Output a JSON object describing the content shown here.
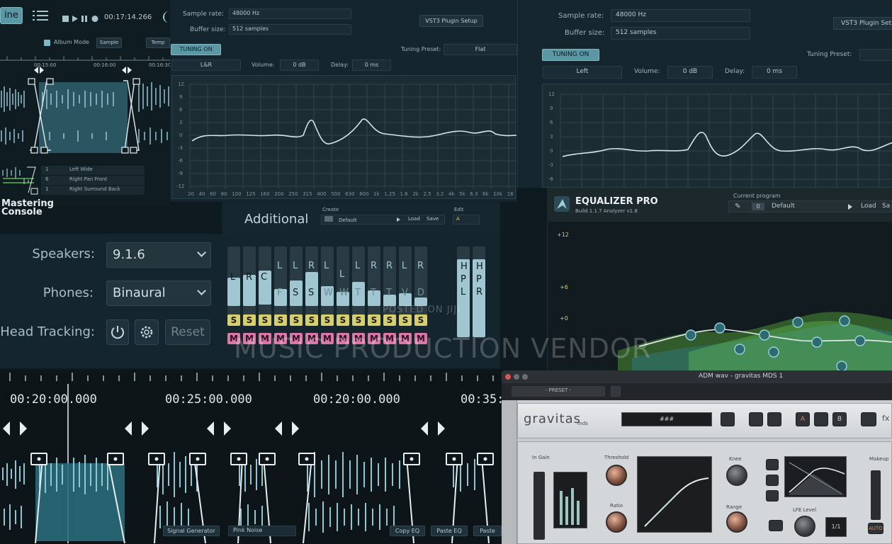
{
  "transport": {
    "play_label": "ine",
    "timecode": "00:17:14.266",
    "tab_a": "Sample",
    "tab_b": "Temp",
    "check_label": "Album Mode"
  },
  "small_timeline": {
    "marks": [
      "00:15:00",
      "00:16:00",
      "00:16:30"
    ]
  },
  "track_list": {
    "rows": [
      {
        "num": "1",
        "name": "Left Wide"
      },
      {
        "num": "6",
        "name": "Right Pan Front"
      },
      {
        "num": "1",
        "name": "Right Surround Back"
      }
    ]
  },
  "brand": {
    "line1": "Mastering",
    "line2": "Console"
  },
  "settings_a": {
    "sample_rate_label": "Sample rate:",
    "sample_rate": "48000 Hz",
    "buffer_label": "Buffer size:",
    "buffer": "512 samples",
    "vst_button": "VST3 Plugin Setup",
    "tuning_button": "TUNING ON",
    "tuning_preset_label": "Tuning Preset:",
    "tuning_preset": "Flat",
    "channel": "L&R",
    "volume_label": "Volume:",
    "volume": "0 dB",
    "delay_label": "Delay:",
    "delay": "0 ms"
  },
  "settings_b": {
    "sample_rate_label": "Sample rate:",
    "sample_rate": "48000 Hz",
    "buffer_label": "Buffer size:",
    "buffer": "512 samples",
    "vst_button": "VST3 Plugin Setup",
    "tuning_button": "TUNING ON",
    "tuning_preset_label": "Tuning Preset:",
    "channel": "Left",
    "volume_label": "Volume:",
    "volume": "0 dB",
    "delay_label": "Delay:",
    "delay": "0 ms"
  },
  "plot_a": {
    "y_ticks": [
      "12",
      "9",
      "6",
      "3",
      "0",
      "-3",
      "-6",
      "-9",
      "-12"
    ],
    "x_ticks": [
      "20",
      "40",
      "60",
      "80",
      "100",
      "125",
      "160",
      "200",
      "250",
      "315",
      "400",
      "500",
      "630",
      "800",
      "1k",
      "1.25",
      "1.6",
      "2k",
      "2.5",
      "3.2",
      "4k",
      "5k",
      "6.3",
      "8k",
      "10k",
      "16"
    ]
  },
  "plot_b": {
    "y_ticks": [
      "12",
      "9",
      "6",
      "3",
      "0",
      "-3",
      "-6"
    ]
  },
  "additional": {
    "title": "Additional",
    "preset_caption": "Create",
    "preset_value": "Default",
    "load": "Load",
    "save": "Save",
    "edit_caption": "Edit",
    "edit_value": "A"
  },
  "speaker": {
    "speakers_label": "Speakers:",
    "speakers_value": "9.1.6",
    "phones_label": "Phones:",
    "phones_value": "Binaural",
    "head_label": "Head Tracking:",
    "reset_label": "Reset"
  },
  "mixer": {
    "channels": [
      "L",
      "R",
      "C",
      "L",
      "L",
      "R",
      "L",
      "L",
      "L",
      "R",
      "R",
      "L",
      "R"
    ],
    "lower_letters": [
      "",
      "",
      "",
      "F",
      "S",
      "S",
      "W",
      "W",
      "T",
      "T",
      "T",
      "V",
      "D"
    ],
    "solo": [
      "S",
      "S",
      "S",
      "S",
      "S",
      "S",
      "S",
      "S",
      "S",
      "S",
      "S",
      "S",
      "S"
    ],
    "mute": [
      "M",
      "M",
      "M",
      "M",
      "M",
      "M",
      "M",
      "M",
      "M",
      "M",
      "M",
      "M",
      "M"
    ],
    "extra_a": [
      "H",
      "P",
      "L"
    ],
    "extra_b": [
      "H",
      "P",
      "R"
    ]
  },
  "big_timeline": {
    "marks": [
      "00:20:00.000",
      "00:25:00.000",
      "00:20:00.000",
      "00:35:0"
    ]
  },
  "bottom_buttons": {
    "signal": "Signal Generator",
    "noise": "Pink Noise",
    "copy": "Copy EQ",
    "paste": "Paste EQ",
    "paste2": "Paste"
  },
  "eq": {
    "name": "EQUALIZER PRO",
    "version": "Build 1.1.7  Analyzer v1.8",
    "current_label": "Current program",
    "program_num": "0",
    "program": "Default",
    "load": "Load",
    "save": "Sa",
    "db_ticks": [
      "+12",
      "+6",
      "+0"
    ]
  },
  "gravitas": {
    "window_title": "ADM wav - gravitas MDS 1",
    "preset": "- PRESET -",
    "logo": "gravitas",
    "logo_sub": "mds",
    "display": "###",
    "in_gain": "In Gain",
    "threshold": "Threshold",
    "knee": "Knee",
    "ratio": "Ratio",
    "range": "Range",
    "makeup": "Makeup",
    "lfe": "LFE Level",
    "auto": "AUTO",
    "ratio_val": "1/1",
    "btn_a": "A",
    "btn_b": "B",
    "fx": "fx"
  },
  "watermark": {
    "line1": "POSTED ON JIJI",
    "line2": "MUSIC PRODUCTION VENDOR"
  },
  "colors": {
    "accent": "#5a98a6",
    "solo": "#d7d06a",
    "mute": "#d978a6",
    "eq_green": "#6ad15a"
  }
}
